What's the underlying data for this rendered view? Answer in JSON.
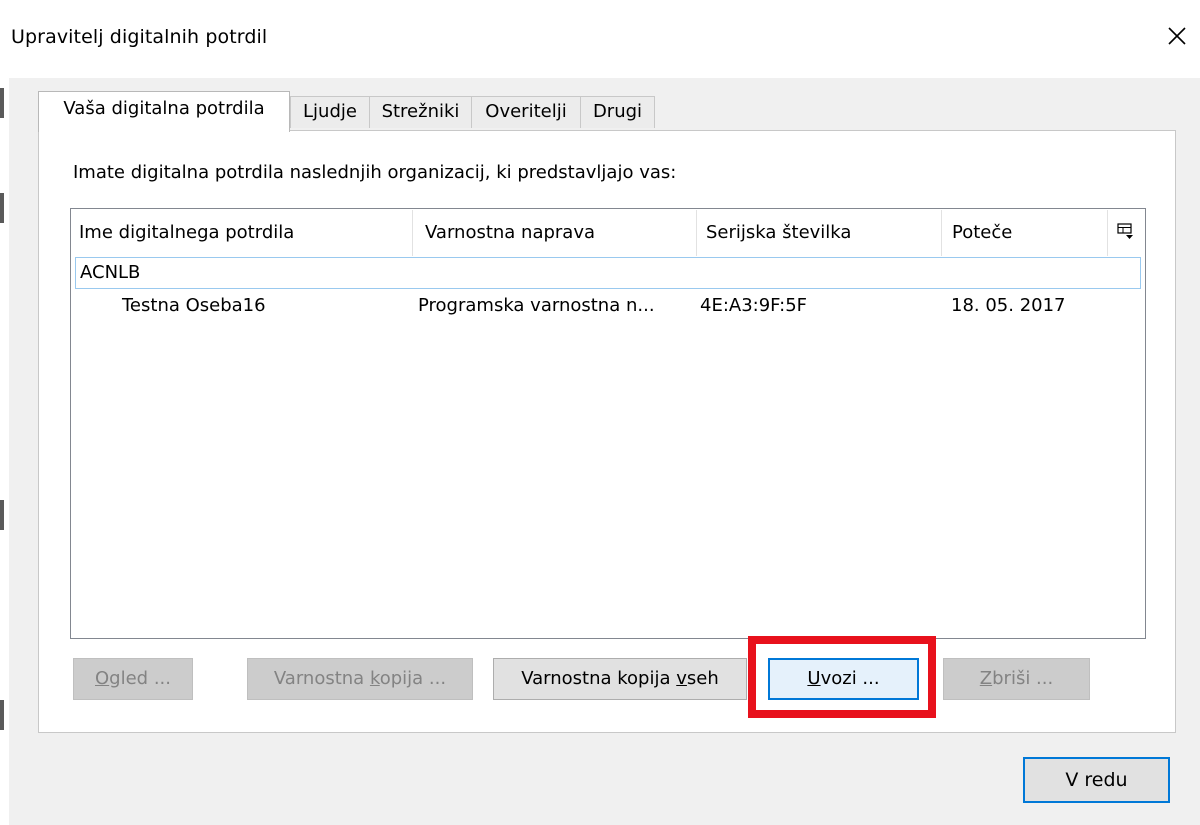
{
  "window": {
    "title": "Upravitelj digitalnih potrdil",
    "close_glyph": "✕"
  },
  "tabs": [
    {
      "label": "Vaša digitalna potrdila",
      "active": true
    },
    {
      "label": "Ljudje",
      "active": false
    },
    {
      "label": "Strežniki",
      "active": false
    },
    {
      "label": "Overitelji",
      "active": false
    },
    {
      "label": "Drugi",
      "active": false
    }
  ],
  "intro_text": "Imate digitalna potrdila naslednjih organizacij, ki predstavljajo vas:",
  "table": {
    "columns": [
      "Ime digitalnega potrdila",
      "Varnostna naprava",
      "Serijska številka",
      "Poteče"
    ],
    "column_picker_icon": "column-picker-icon",
    "groups": [
      {
        "name": "ACNLB",
        "expanded": true,
        "rows": [
          {
            "name": "Testna Oseba16",
            "device": "Programska varnostna n...",
            "serial": "4E:A3:9F:5F",
            "expires": "18. 05. 2017"
          }
        ]
      }
    ]
  },
  "buttons": {
    "view": {
      "pre": "",
      "accel": "O",
      "post": "gled ...",
      "enabled": false
    },
    "backup": {
      "pre": "Varnostna ",
      "accel": "k",
      "post": "opija ...",
      "enabled": false
    },
    "backup_all": {
      "pre": "Varnostna kopija ",
      "accel": "v",
      "post": "seh",
      "enabled": true
    },
    "import": {
      "pre": "",
      "accel": "U",
      "post": "vozi ...",
      "enabled": true
    },
    "delete": {
      "pre": "",
      "accel": "Z",
      "post": "briši ...",
      "enabled": false
    }
  },
  "ok_button": {
    "label": "V redu"
  },
  "colors": {
    "highlight": "#e8111c",
    "focus": "#0078d7",
    "selection_border": "#99c9ef"
  }
}
